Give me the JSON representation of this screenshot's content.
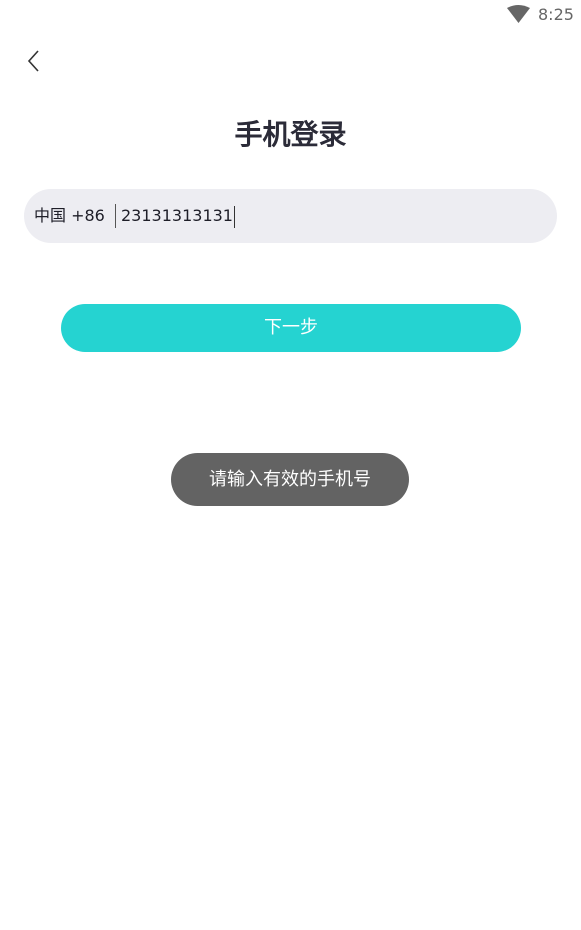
{
  "status_bar": {
    "time": "8:25",
    "wifi_icon": "wifi-icon"
  },
  "header": {
    "back_icon": "chevron-left-icon",
    "title": "手机登录"
  },
  "phone_form": {
    "country_code": "中国 +86",
    "phone_value": "23131313131"
  },
  "next_button": {
    "label": "下一步"
  },
  "toast": {
    "message": "请输入有效的手机号"
  },
  "colors": {
    "accent": "#25d3d1",
    "input_bg": "#ededf2",
    "toast_bg": "#636363",
    "title_text": "#2b2b38"
  }
}
